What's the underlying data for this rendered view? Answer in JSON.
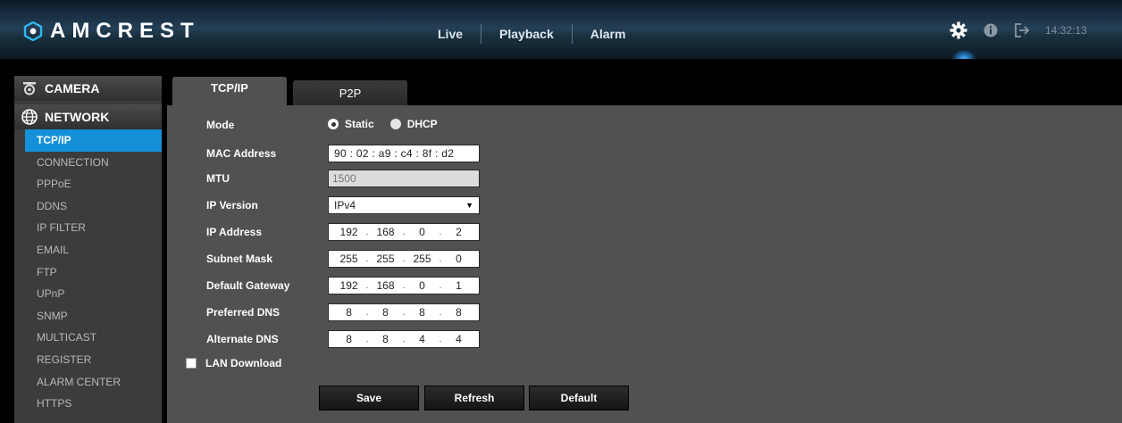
{
  "header": {
    "brand": "AMCREST",
    "nav": [
      "Live",
      "Playback",
      "Alarm"
    ],
    "time": "14:32:13",
    "icons": [
      "gear-icon",
      "info-icon",
      "logout-icon"
    ]
  },
  "sidebar": {
    "camera_label": "CAMERA",
    "network_label": "NETWORK",
    "items": [
      "TCP/IP",
      "CONNECTION",
      "PPPoE",
      "DDNS",
      "IP FILTER",
      "EMAIL",
      "FTP",
      "UPnP",
      "SNMP",
      "MULTICAST",
      "REGISTER",
      "ALARM CENTER",
      "HTTPS"
    ],
    "active_item": "TCP/IP"
  },
  "tabs": [
    "TCP/IP",
    "P2P"
  ],
  "form": {
    "mode_label": "Mode",
    "mode_options": [
      "Static",
      "DHCP"
    ],
    "mode_selected": "Static",
    "mac_label": "MAC Address",
    "mac": [
      "90",
      "02",
      "a9",
      "c4",
      "8f",
      "d2"
    ],
    "mtu_label": "MTU",
    "mtu": "1500",
    "ipver_label": "IP Version",
    "ipver": "IPv4",
    "ip_label": "IP Address",
    "ip": [
      "192",
      "168",
      "0",
      "2"
    ],
    "subnet_label": "Subnet Mask",
    "subnet": [
      "255",
      "255",
      "255",
      "0"
    ],
    "gateway_label": "Default Gateway",
    "gateway": [
      "192",
      "168",
      "0",
      "1"
    ],
    "dns1_label": "Preferred DNS",
    "dns1": [
      "8",
      "8",
      "8",
      "8"
    ],
    "dns2_label": "Alternate DNS",
    "dns2": [
      "8",
      "8",
      "4",
      "4"
    ],
    "lan_download_label": "LAN Download",
    "lan_download_checked": false
  },
  "buttons": {
    "save": "Save",
    "refresh": "Refresh",
    "default": "Default"
  },
  "colors": {
    "accent": "#1490d8",
    "header_bg": "#1a3145",
    "content_bg": "#515151",
    "sidebar_bg": "#3c3c3c"
  }
}
